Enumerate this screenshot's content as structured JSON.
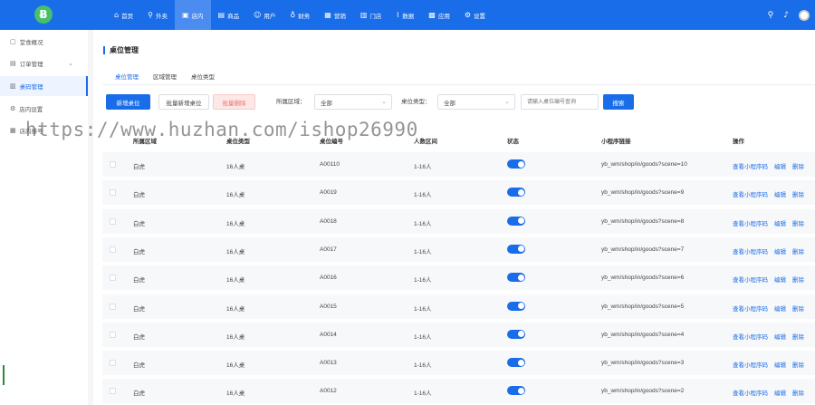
{
  "topbar": {
    "logo_text": "Ƀ",
    "nav": [
      {
        "label": "首页",
        "icon": "home-icon",
        "glyph": "⌂"
      },
      {
        "label": "外卖",
        "icon": "takeout-icon",
        "glyph": "⚲"
      },
      {
        "label": "店内",
        "icon": "dine-in-icon",
        "glyph": "▣",
        "active": true
      },
      {
        "label": "商品",
        "icon": "goods-icon",
        "glyph": "▤"
      },
      {
        "label": "用户",
        "icon": "user-icon",
        "glyph": "☺"
      },
      {
        "label": "财务",
        "icon": "finance-icon",
        "glyph": "♁"
      },
      {
        "label": "营销",
        "icon": "marketing-icon",
        "glyph": "▦"
      },
      {
        "label": "门店",
        "icon": "store-icon",
        "glyph": "▥"
      },
      {
        "label": "数据",
        "icon": "data-icon",
        "glyph": "⌇"
      },
      {
        "label": "应用",
        "icon": "apps-icon",
        "glyph": "▩"
      },
      {
        "label": "设置",
        "icon": "settings-icon",
        "glyph": "⚙"
      }
    ],
    "search_glyph": "⚲",
    "bell_glyph": "♪"
  },
  "sidebar": {
    "items": [
      {
        "label": "堂食概况",
        "icon": "overview-icon",
        "glyph": "▢"
      },
      {
        "label": "订单管理",
        "icon": "order-icon",
        "glyph": "▤",
        "chevron": "⌄"
      },
      {
        "label": "桌码管理",
        "icon": "table-code-icon",
        "glyph": "▥",
        "active": true
      },
      {
        "label": "店内设置",
        "icon": "settings-icon",
        "glyph": "⚙"
      },
      {
        "label": "店内排号",
        "icon": "queue-icon",
        "glyph": "▦"
      }
    ]
  },
  "main": {
    "title": "桌位管理",
    "tabs": [
      "桌位管理",
      "区域管理",
      "桌位类型"
    ],
    "toolbar": {
      "add_label": "新增桌位",
      "batch_add_label": "批量新增桌位",
      "batch_delete_label": "批量删除",
      "area_label": "所属区域：",
      "area_value": "全部",
      "type_label": "桌位类型：",
      "type_value": "全部",
      "search_placeholder": "请输入桌位编号查询",
      "search_button": "搜索"
    },
    "columns": [
      "所属区域",
      "桌位类型",
      "桌位编号",
      "人数区间",
      "状态",
      "小程序链接",
      "操作"
    ],
    "actions": {
      "view": "查看小程序码",
      "edit": "编辑",
      "delete": "删除"
    },
    "rows": [
      {
        "area": "白虎",
        "type": "16人桌",
        "code": "A00110",
        "range": "1-16人",
        "status": true,
        "link": "yb_wm/shop/in/goods?scene=10"
      },
      {
        "area": "白虎",
        "type": "16人桌",
        "code": "A0019",
        "range": "1-16人",
        "status": true,
        "link": "yb_wm/shop/in/goods?scene=9"
      },
      {
        "area": "白虎",
        "type": "16人桌",
        "code": "A0018",
        "range": "1-16人",
        "status": true,
        "link": "yb_wm/shop/in/goods?scene=8"
      },
      {
        "area": "白虎",
        "type": "16人桌",
        "code": "A0017",
        "range": "1-16人",
        "status": true,
        "link": "yb_wm/shop/in/goods?scene=7"
      },
      {
        "area": "白虎",
        "type": "16人桌",
        "code": "A0016",
        "range": "1-16人",
        "status": true,
        "link": "yb_wm/shop/in/goods?scene=6"
      },
      {
        "area": "白虎",
        "type": "16人桌",
        "code": "A0015",
        "range": "1-16人",
        "status": true,
        "link": "yb_wm/shop/in/goods?scene=5"
      },
      {
        "area": "白虎",
        "type": "16人桌",
        "code": "A0014",
        "range": "1-16人",
        "status": true,
        "link": "yb_wm/shop/in/goods?scene=4"
      },
      {
        "area": "白虎",
        "type": "16人桌",
        "code": "A0013",
        "range": "1-16人",
        "status": true,
        "link": "yb_wm/shop/in/goods?scene=3"
      },
      {
        "area": "白虎",
        "type": "16人桌",
        "code": "A0012",
        "range": "1-16人",
        "status": true,
        "link": "yb_wm/shop/in/goods?scene=2"
      }
    ]
  },
  "watermark": "https://www.huzhan.com/ishop26990",
  "colors": {
    "primary": "#1a6de8",
    "logo": "#46c06a",
    "danger": "#f56c6c"
  }
}
